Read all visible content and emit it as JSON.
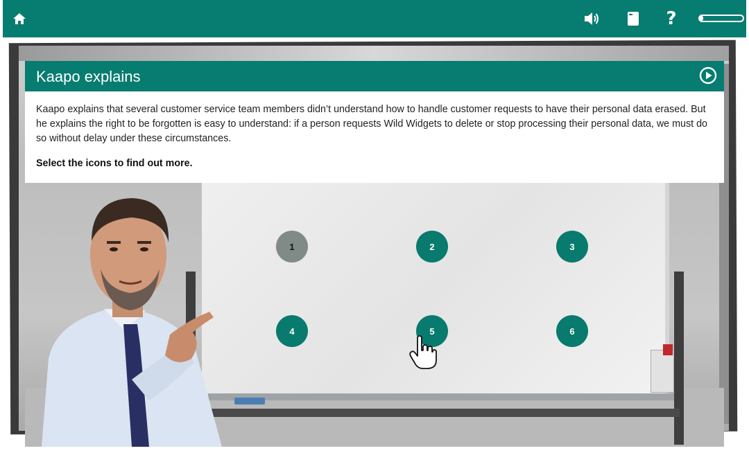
{
  "topbar": {
    "icons": [
      "home-icon",
      "speaker-icon",
      "book-icon",
      "help-icon"
    ],
    "help_glyph": "?",
    "progress_fraction": 0.08,
    "background_color": "#077c70"
  },
  "panel": {
    "title": "Kaapo explains",
    "play_icon": "play-circle-icon",
    "body": "Kaapo explains that several customer service team members didn’t understand how to handle customer requests to have their personal data erased. But he explains the right to be forgotten is easy to understand: if a person requests Wild Widgets to delete or stop processing their personal data, we must do so without delay under these circumstances.",
    "instruction": "Select the icons to find out more."
  },
  "hotspots": [
    {
      "label": "1",
      "state": "visited"
    },
    {
      "label": "2",
      "state": "unvisited"
    },
    {
      "label": "3",
      "state": "unvisited"
    },
    {
      "label": "4",
      "state": "unvisited"
    },
    {
      "label": "5",
      "state": "unvisited"
    },
    {
      "label": "6",
      "state": "unvisited"
    }
  ],
  "colors": {
    "accent": "#077c70",
    "visited": "#808a86"
  }
}
